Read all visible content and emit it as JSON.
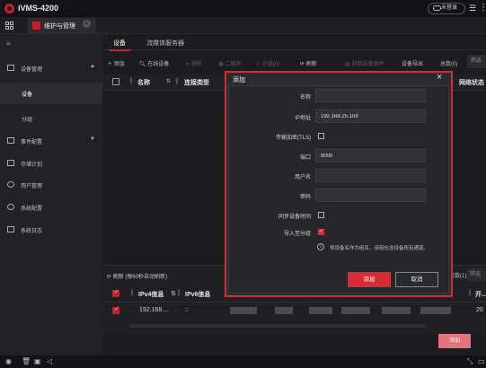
{
  "app": {
    "title": "iVMS-4200",
    "cloud_label": "未登录"
  },
  "tab": {
    "label": "维护与管理"
  },
  "sidebar": {
    "items": [
      {
        "label": "设备管理",
        "expandable": true
      },
      {
        "label": "设备",
        "selected": true
      },
      {
        "label": "分组"
      },
      {
        "label": "事件配置",
        "expandable": true
      },
      {
        "label": "存储计划"
      },
      {
        "label": "用户管理"
      },
      {
        "label": "系统配置"
      },
      {
        "label": "系统日志"
      }
    ]
  },
  "subtabs": {
    "device": "设备",
    "stream": "流媒体服务器"
  },
  "toolbar": {
    "add": "添加",
    "online": "在线设备",
    "delete": "删除",
    "qrcode": "二维码",
    "upgrade": "升级(0)",
    "refresh": "刷新",
    "event": "获取设备事件",
    "hotspot": "设备导出",
    "total": "总数(0)",
    "filter": "筛选"
  },
  "table": {
    "headers": {
      "name": "名称",
      "conn": "连接类型",
      "net": "网络状态"
    }
  },
  "lower": {
    "refresh": "刷新 (每60秒自动刷新)",
    "count": "总数(1)",
    "filter": "筛选",
    "headers": {
      "ipv4": "IPv4信息",
      "ipv6": "IPv6信息",
      "port": "开..."
    },
    "row": {
      "ipv4": "192.168....",
      "ipv6": "::",
      "port": "20"
    },
    "add_button": "添加"
  },
  "dialog": {
    "title": "添加",
    "fields": {
      "name_label": "名称",
      "name_value": "",
      "ip_label": "IP地址",
      "ip_value": "192.168.25.109",
      "tls_label": "传输加密(TLS)",
      "port_label": "端口",
      "port_value": "8000",
      "user_label": "用户名",
      "user_value": "",
      "pwd_label": "密码",
      "pwd_value": "",
      "sync_label": "同步设备时间",
      "import_label": "导入至分组"
    },
    "info": "将设备名作为组名，该组包含设备所有通道。",
    "add_label": "添加",
    "cancel_label": "取消"
  },
  "colors": {
    "accent": "#d92b33",
    "background": "#1b1c20"
  }
}
